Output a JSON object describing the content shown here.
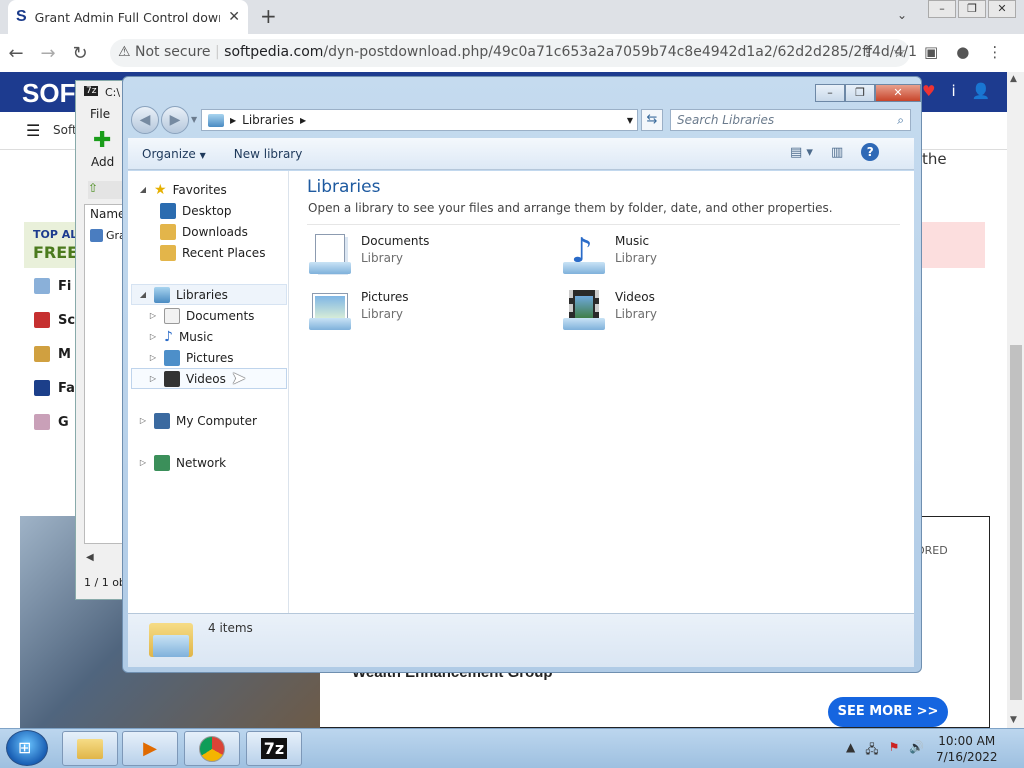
{
  "browser": {
    "tab_title": "Grant Admin Full Control downlo",
    "security_label": "Not secure",
    "url_host": "softpedia.com",
    "url_path": "/dyn-postdownload.php/49c0a71c653a2a7059b74c8e4942d1a2/62d2d285/2ff4d/4/1"
  },
  "website": {
    "logo": "SOF",
    "nav_snippet": "Soft",
    "body_snippet": "the",
    "top_alt_label": "TOP ALT",
    "free_label": "FREE",
    "sidebar_snippets": [
      "Fi",
      "Sc",
      "M",
      "Fa",
      "G"
    ],
    "ad": {
      "sponsored": "ORED",
      "brand": "Wealth Enhancement Group",
      "cta": "SEE MORE >>"
    }
  },
  "zip_window": {
    "title": "C:\\",
    "menu_file": "File",
    "add_label": "Add",
    "col_name": "Name",
    "row_name": "Gra",
    "status": "1 / 1 ob"
  },
  "explorer": {
    "breadcrumb": "Libraries",
    "search_placeholder": "Search Libraries",
    "toolbar": {
      "organize": "Organize",
      "new_library": "New library"
    },
    "nav": {
      "favorites": "Favorites",
      "favorites_items": [
        "Desktop",
        "Downloads",
        "Recent Places"
      ],
      "libraries": "Libraries",
      "libraries_items": [
        "Documents",
        "Music",
        "Pictures",
        "Videos"
      ],
      "computer": "My Computer",
      "network": "Network"
    },
    "content": {
      "title": "Libraries",
      "subtitle": "Open a library to see your files and arrange them by folder, date, and other properties.",
      "items": [
        {
          "name": "Documents",
          "kind": "Library"
        },
        {
          "name": "Music",
          "kind": "Library"
        },
        {
          "name": "Pictures",
          "kind": "Library"
        },
        {
          "name": "Videos",
          "kind": "Library"
        }
      ]
    },
    "details": {
      "count": "4 items"
    }
  },
  "taskbar": {
    "zip_label": "7z",
    "time": "10:00 AM",
    "date": "7/16/2022"
  }
}
